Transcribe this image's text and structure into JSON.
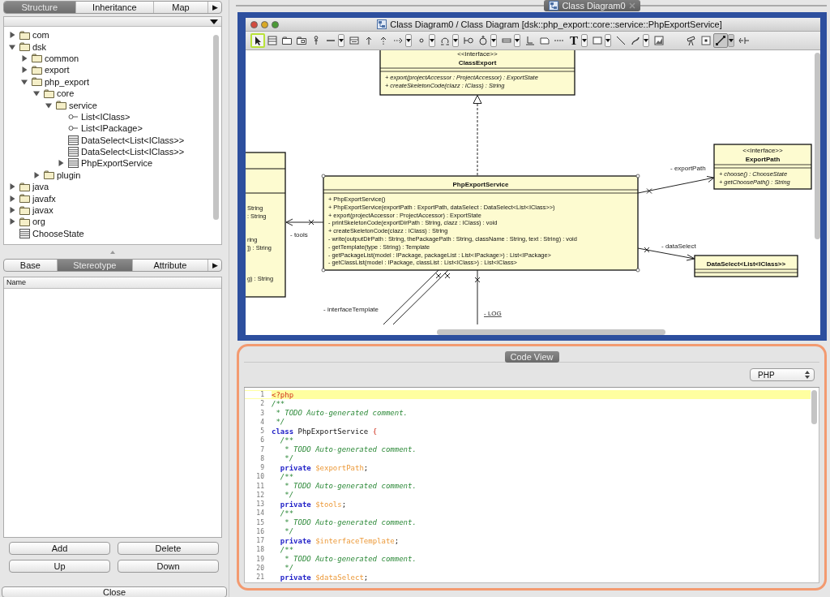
{
  "left_panel": {
    "tabs": [
      {
        "label": "Structure",
        "selected": true
      },
      {
        "label": "Inheritance",
        "selected": false
      },
      {
        "label": "Map",
        "selected": false
      }
    ],
    "tabs_more": "▶",
    "tree": [
      {
        "label": "com",
        "kind": "package",
        "expanded": false
      },
      {
        "label": "dsk",
        "kind": "package",
        "expanded": true,
        "children": [
          {
            "label": "common",
            "kind": "package",
            "expanded": false
          },
          {
            "label": "export",
            "kind": "package",
            "expanded": false
          },
          {
            "label": "php_export",
            "kind": "package",
            "expanded": true,
            "children": [
              {
                "label": "core",
                "kind": "package",
                "expanded": true,
                "children": [
                  {
                    "label": "service",
                    "kind": "package",
                    "expanded": true,
                    "children": [
                      {
                        "label": "List<IClass>",
                        "kind": "interface"
                      },
                      {
                        "label": "List<IPackage>",
                        "kind": "interface"
                      },
                      {
                        "label": "DataSelect<List<IClass>>",
                        "kind": "class"
                      },
                      {
                        "label": "DataSelect<List<IClass>>",
                        "kind": "class"
                      },
                      {
                        "label": "PhpExportService",
                        "kind": "class",
                        "expanded": false
                      }
                    ]
                  }
                ]
              },
              {
                "label": "plugin",
                "kind": "package",
                "expanded": false
              }
            ]
          }
        ]
      },
      {
        "label": "java",
        "kind": "package",
        "expanded": false
      },
      {
        "label": "javafx",
        "kind": "package",
        "expanded": false
      },
      {
        "label": "javax",
        "kind": "package",
        "expanded": false
      },
      {
        "label": "org",
        "kind": "package",
        "expanded": false
      },
      {
        "label": "ChooseState",
        "kind": "class"
      }
    ],
    "property_tabs": [
      {
        "label": "Base",
        "selected": false
      },
      {
        "label": "Stereotype",
        "selected": true
      },
      {
        "label": "Attribute",
        "selected": false
      }
    ],
    "property_tabs_more": "▶",
    "table": {
      "columns": [
        "Name"
      ]
    },
    "buttons": [
      "Add",
      "Delete",
      "Up",
      "Down"
    ],
    "close_button": "Close"
  },
  "editor_tab": {
    "title": "Class Diagram0"
  },
  "diagram_window": {
    "title": "Class Diagram0 / Class Diagram [dsk::php_export::core::service::PhpExportService]",
    "tools": [
      {
        "selected": true,
        "dropdown": false
      },
      {
        "selected": false,
        "dropdown": false
      },
      {
        "selected": false,
        "dropdown": false
      },
      {
        "selected": false,
        "dropdown": false
      },
      {
        "selected": false,
        "dropdown": false
      },
      {
        "selected": false,
        "dropdown": true
      },
      {
        "selected": false,
        "dropdown": false
      },
      {
        "selected": false,
        "dropdown": false
      },
      {
        "selected": false,
        "dropdown": false
      },
      {
        "selected": false,
        "dropdown": true
      },
      {
        "selected": false,
        "dropdown": true
      },
      {
        "selected": false,
        "dropdown": true
      },
      {
        "selected": false,
        "dropdown": false
      },
      {
        "selected": false,
        "dropdown": true
      },
      {
        "selected": false,
        "dropdown": true
      },
      {
        "selected": false,
        "dropdown": false
      },
      {
        "selected": false,
        "dropdown": false
      },
      {
        "selected": false,
        "dropdown": false
      },
      {
        "selected": false,
        "dropdown": true,
        "label": "T"
      },
      {
        "selected": false,
        "dropdown": true
      },
      {
        "selected": false,
        "dropdown": false
      },
      {
        "selected": false,
        "dropdown": true
      },
      {
        "selected": false,
        "dropdown": false
      },
      {
        "selected": false,
        "dropdown": false
      },
      {
        "selected": false,
        "dropdown": false
      },
      {
        "selected": true,
        "dropdown": true
      },
      {
        "selected": false,
        "dropdown": false
      }
    ],
    "classes": [
      {
        "kind": "interface",
        "stereotype": "<<interface>>",
        "name": "ClassExport",
        "operations": [
          "+ export(projectAccessor : ProjectAccessor) : ExportState",
          "+ createSkeletonCode(clazz : IClass) : String"
        ]
      },
      {
        "kind": "class",
        "name": "PhpExportService",
        "operations": [
          "+ PhpExportService()",
          "+ PhpExportService(exportPath : ExportPath, dataSelect : DataSelect<List<IClass>>)",
          "+ export(projectAccessor : ProjectAccessor) : ExportState",
          "- printSkeletonCode(exportDirPath : String, clazz : IClass) : void",
          "+ createSkeletonCode(clazz : IClass) : String",
          "- write(outputDirPath : String, thePackagePath : String, className : String, text : String) : void",
          "- getTemplate(type : String) : Template",
          "- getPackageList(model : IPackage, packageList : List<IPackage>) : List<IPackage>",
          "- getClassList(model : IPackage, classList : List<IClass>) : List<IClass>"
        ]
      },
      {
        "kind": "interface",
        "stereotype": "<<interface>>",
        "name": "ExportPath",
        "operations": [
          "+ choose() : ChooseState",
          "+ getChoosePath() : String"
        ]
      },
      {
        "kind": "class",
        "name": "DataSelect<List<IClass>>"
      },
      {
        "kind": "cut",
        "operations": [
          "String",
          ": String",
          "ring",
          "]) : String",
          "g) : String"
        ]
      }
    ],
    "associations": [
      {
        "label": "- tools",
        "static": false
      },
      {
        "label": "- exportPath",
        "static": false
      },
      {
        "label": "- dataSelect",
        "static": false
      },
      {
        "label": "- interfaceTemplate",
        "static": false
      },
      {
        "label": "- LOG",
        "static": true
      }
    ]
  },
  "code_view": {
    "title": "Code View",
    "language": "PHP",
    "lines": [
      {
        "number": "1",
        "selected": true,
        "tokens": [
          {
            "kind": "tag",
            "text": "<?php"
          }
        ]
      },
      {
        "number": "2",
        "selected": false,
        "tokens": [
          {
            "kind": "comment",
            "text": "/**"
          }
        ]
      },
      {
        "number": "3",
        "selected": false,
        "tokens": [
          {
            "kind": "comment",
            "text": " * TODO Auto-generated comment."
          }
        ]
      },
      {
        "number": "4",
        "selected": false,
        "tokens": [
          {
            "kind": "comment",
            "text": " */"
          }
        ]
      },
      {
        "number": "5",
        "selected": false,
        "tokens": [
          {
            "kind": "keyword",
            "text": "class"
          },
          {
            "kind": "plain",
            "text": " PhpExportService "
          },
          {
            "kind": "brace",
            "text": "{"
          }
        ]
      },
      {
        "number": "6",
        "selected": false,
        "tokens": [
          {
            "kind": "comment",
            "text": "  /**"
          }
        ]
      },
      {
        "number": "7",
        "selected": false,
        "tokens": [
          {
            "kind": "comment",
            "text": "   * TODO Auto-generated comment."
          }
        ]
      },
      {
        "number": "8",
        "selected": false,
        "tokens": [
          {
            "kind": "comment",
            "text": "   */"
          }
        ]
      },
      {
        "number": "9",
        "selected": false,
        "tokens": [
          {
            "kind": "keyword",
            "text": "  private"
          },
          {
            "kind": "variable",
            "text": " $exportPath"
          },
          {
            "kind": "plain",
            "text": ";"
          }
        ]
      },
      {
        "number": "10",
        "selected": false,
        "tokens": [
          {
            "kind": "comment",
            "text": "  /**"
          }
        ]
      },
      {
        "number": "11",
        "selected": false,
        "tokens": [
          {
            "kind": "comment",
            "text": "   * TODO Auto-generated comment."
          }
        ]
      },
      {
        "number": "12",
        "selected": false,
        "tokens": [
          {
            "kind": "comment",
            "text": "   */"
          }
        ]
      },
      {
        "number": "13",
        "selected": false,
        "tokens": [
          {
            "kind": "keyword",
            "text": "  private"
          },
          {
            "kind": "variable",
            "text": " $tools"
          },
          {
            "kind": "plain",
            "text": ";"
          }
        ]
      },
      {
        "number": "14",
        "selected": false,
        "tokens": [
          {
            "kind": "comment",
            "text": "  /**"
          }
        ]
      },
      {
        "number": "15",
        "selected": false,
        "tokens": [
          {
            "kind": "comment",
            "text": "   * TODO Auto-generated comment."
          }
        ]
      },
      {
        "number": "16",
        "selected": false,
        "tokens": [
          {
            "kind": "comment",
            "text": "   */"
          }
        ]
      },
      {
        "number": "17",
        "selected": false,
        "tokens": [
          {
            "kind": "keyword",
            "text": "  private"
          },
          {
            "kind": "variable",
            "text": " $interfaceTemplate"
          },
          {
            "kind": "plain",
            "text": ";"
          }
        ]
      },
      {
        "number": "18",
        "selected": false,
        "tokens": [
          {
            "kind": "comment",
            "text": "  /**"
          }
        ]
      },
      {
        "number": "19",
        "selected": false,
        "tokens": [
          {
            "kind": "comment",
            "text": "   * TODO Auto-generated comment."
          }
        ]
      },
      {
        "number": "20",
        "selected": false,
        "tokens": [
          {
            "kind": "comment",
            "text": "   */"
          }
        ]
      },
      {
        "number": "21",
        "selected": false,
        "tokens": [
          {
            "kind": "keyword",
            "text": "  private"
          },
          {
            "kind": "variable",
            "text": " $dataSelect"
          },
          {
            "kind": "plain",
            "text": ";"
          }
        ]
      }
    ]
  }
}
